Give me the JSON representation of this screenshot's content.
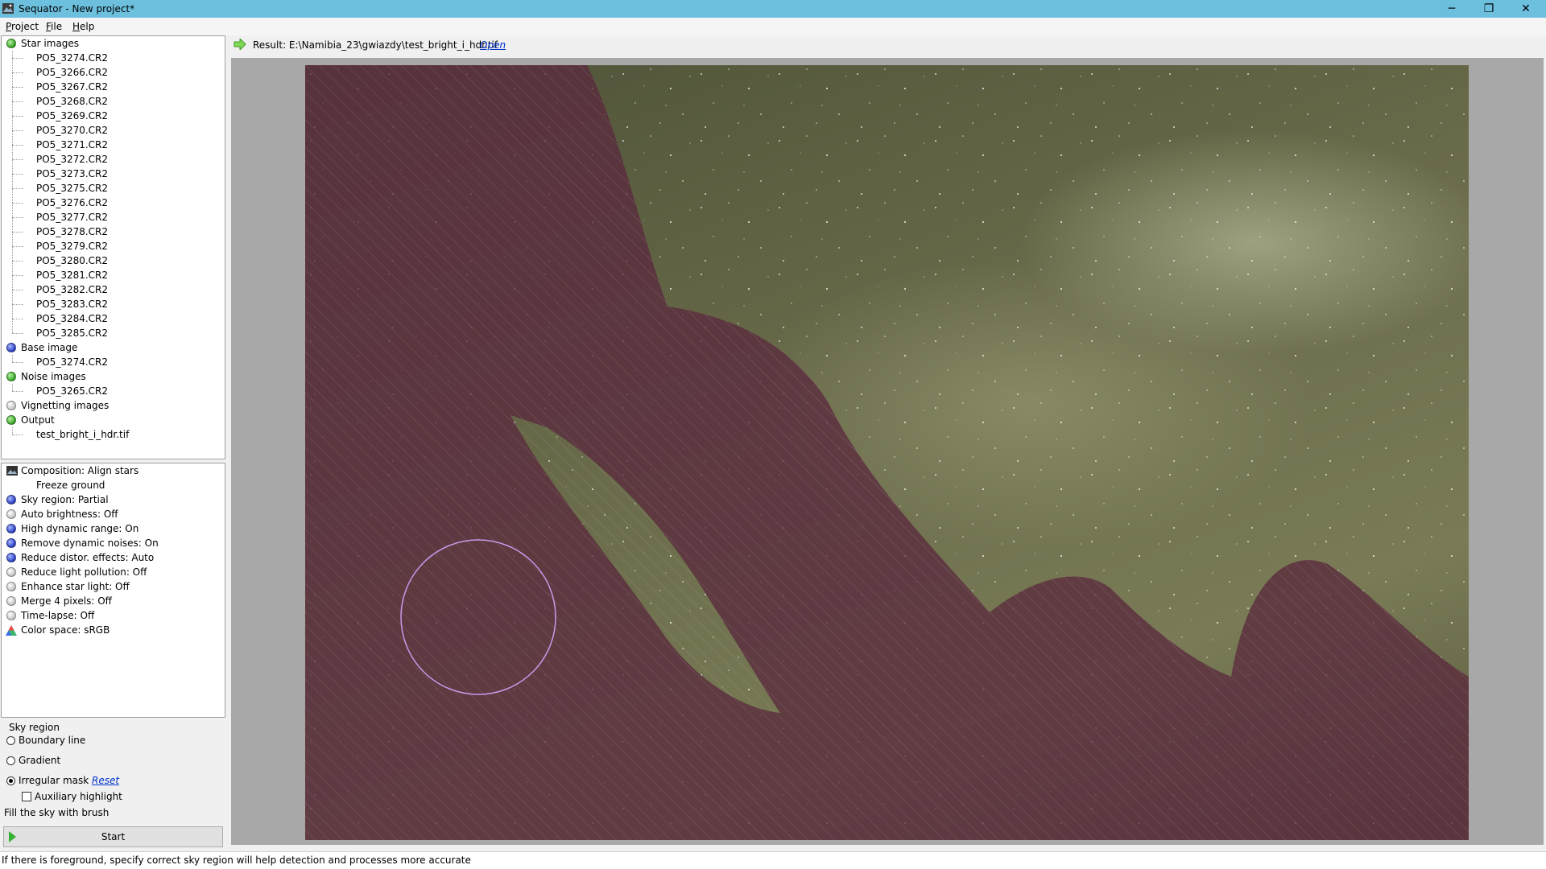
{
  "window": {
    "title": "Sequator - New project*",
    "minimize_glyph": "─",
    "maximize_glyph": "❐",
    "close_glyph": "✕"
  },
  "menu": {
    "items": [
      {
        "accel": "P",
        "rest": "roject"
      },
      {
        "accel": "F",
        "rest": "ile"
      },
      {
        "accel": "H",
        "rest": "elp"
      }
    ]
  },
  "tree": {
    "star_images": {
      "label": "Star images",
      "status": "green",
      "files": [
        "PO5_3274.CR2",
        "PO5_3266.CR2",
        "PO5_3267.CR2",
        "PO5_3268.CR2",
        "PO5_3269.CR2",
        "PO5_3270.CR2",
        "PO5_3271.CR2",
        "PO5_3272.CR2",
        "PO5_3273.CR2",
        "PO5_3275.CR2",
        "PO5_3276.CR2",
        "PO5_3277.CR2",
        "PO5_3278.CR2",
        "PO5_3279.CR2",
        "PO5_3280.CR2",
        "PO5_3281.CR2",
        "PO5_3282.CR2",
        "PO5_3283.CR2",
        "PO5_3284.CR2",
        "PO5_3285.CR2"
      ]
    },
    "base_image": {
      "label": "Base image",
      "status": "blue",
      "files": [
        "PO5_3274.CR2"
      ]
    },
    "noise_images": {
      "label": "Noise images",
      "status": "green",
      "files": [
        "PO5_3265.CR2"
      ]
    },
    "vignetting_images": {
      "label": "Vignetting images",
      "status": "gray",
      "files": []
    },
    "output": {
      "label": "Output",
      "status": "green",
      "files": [
        "test_bright_i_hdr.tif"
      ]
    }
  },
  "options": {
    "composition": "Composition: Align stars",
    "freeze_ground": "Freeze ground",
    "items": [
      {
        "label": "Sky region: Partial",
        "status": "blue"
      },
      {
        "label": "Auto brightness: Off",
        "status": "gray"
      },
      {
        "label": "High dynamic range: On",
        "status": "blue"
      },
      {
        "label": "Remove dynamic noises: On",
        "status": "blue"
      },
      {
        "label": "Reduce distor. effects: Auto",
        "status": "blue"
      },
      {
        "label": "Reduce light pollution: Off",
        "status": "gray"
      },
      {
        "label": "Enhance star light: Off",
        "status": "gray"
      },
      {
        "label": "Merge 4 pixels: Off",
        "status": "gray"
      },
      {
        "label": "Time-lapse: Off",
        "status": "gray"
      }
    ],
    "color_space": "Color space: sRGB"
  },
  "sky_region": {
    "heading": "Sky region",
    "boundary_line": "Boundary line",
    "gradient": "Gradient",
    "irregular_mask": "Irregular mask",
    "reset": "Reset",
    "auxiliary_highlight": "Auxiliary highlight",
    "selected": "irregular_mask",
    "auxiliary_checked": false,
    "hint": "Fill the sky with brush"
  },
  "start_button": "Start",
  "result": {
    "label": "Result: E:\\Namibia_23\\gwiazdy\\test_bright_i_hdr.tif",
    "open": "Open"
  },
  "status_bar": "If there is foreground, specify correct sky region will help detection and processes more accurate",
  "colors": {
    "titlebar": "#6cc0de",
    "mask_tint": "#5a2a3e",
    "brush_circle": "#c59be8",
    "link": "#0033cc"
  }
}
